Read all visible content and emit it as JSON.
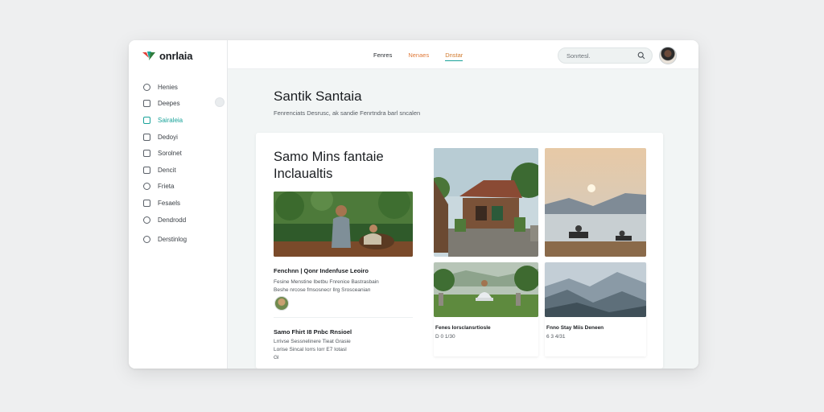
{
  "app": {
    "name": "onrlaia"
  },
  "colors": {
    "accent": "#1aa39a",
    "tab_orange": "#e07a3a"
  },
  "sidebar": {
    "items": [
      {
        "label": "Henies",
        "icon": "clock-icon"
      },
      {
        "label": "Deepes",
        "icon": "home-icon"
      },
      {
        "label": "Sairaleia",
        "icon": "calendar-icon",
        "active": true
      },
      {
        "label": "Dedoyi",
        "icon": "clock-icon"
      },
      {
        "label": "Sorolnet",
        "icon": "lock-icon"
      },
      {
        "label": "Dencit",
        "icon": "tag-icon"
      },
      {
        "label": "Frieta",
        "icon": "clock-icon"
      },
      {
        "label": "Fesaels",
        "icon": "chat-icon"
      },
      {
        "label": "Dendrodd",
        "icon": "help-icon"
      },
      {
        "label": "Derstinlog",
        "icon": "plus-circle-icon"
      }
    ]
  },
  "header": {
    "tabs": [
      "Fenres",
      "Nenaes",
      "Dnstar"
    ],
    "search_placeholder": "Sonrtesl.",
    "avatar_icon": "user-avatar"
  },
  "page": {
    "title": "Santik Santaia",
    "subtitle": "Fenrenciats Desrusc, ak sandie Fenrtndra barl sncalen"
  },
  "feature": {
    "title": "Samo Mins fantaie Inclaualtis",
    "card_title": "Fenchnn | Qonr Indenfuse Leoiro",
    "card_body_1": "Fesine Menstine Ibetbu Fnrenice Bastrasbain",
    "card_body_2": "Beshe nrcose fmsosnecr Ilrg Srosceanian",
    "small_title": "Samo Fhirt I8 Pnbc Rnsioel",
    "small_body_1": "Lrrivse Sessnelinere Tieat Grasie",
    "small_body_2": "Lorise Sincal Iorrs Iorr E7 Iotasl",
    "small_body_3": "Gl"
  },
  "gallery": [
    {
      "alt": "wooden-house-photo"
    },
    {
      "alt": "lake-sunset-photo"
    },
    {
      "alt": "meditation-garden-photo",
      "title": "Fenes Iorsclansrtiosle",
      "meta": "D 0 1/30"
    },
    {
      "alt": "mountain-valley-photo",
      "title": "Fnno Stay Miis Deneen",
      "meta": "6 3 4/31"
    }
  ]
}
